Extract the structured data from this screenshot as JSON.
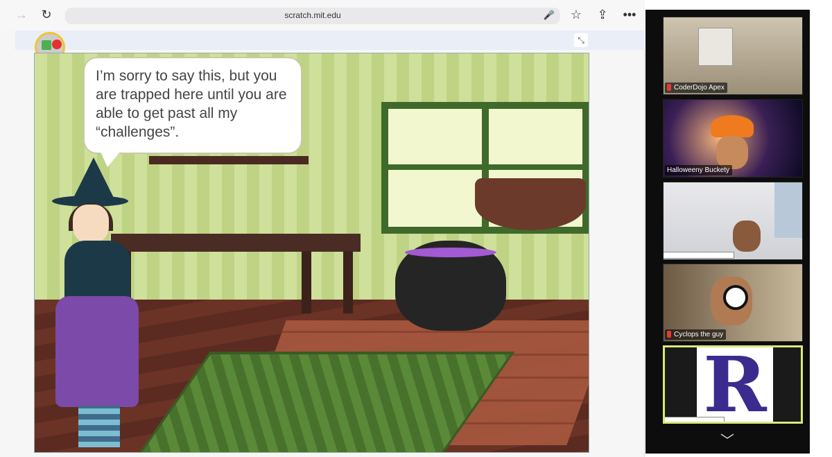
{
  "browser": {
    "url": "scratch.mit.edu",
    "icons": {
      "forward": "arrow-right-icon",
      "reload": "reload-icon",
      "mic": "microphone-icon",
      "bookmark": "star-icon",
      "share": "share-icon",
      "more": "ellipsis-icon",
      "fullscreen": "shrink-icon"
    }
  },
  "stage": {
    "speech": "I’m sorry to say this, but you are trapped here until you are able to get past all my “challenges”."
  },
  "participants": [
    {
      "name": "CoderDojo Apex",
      "muted": true
    },
    {
      "name": "Halloweeny Buckety",
      "muted": false
    },
    {
      "name": "",
      "muted": false
    },
    {
      "name": "Cyclops the guy",
      "muted": true
    },
    {
      "name": "",
      "muted": false
    }
  ],
  "colors": {
    "accent_active": "#d9e87a",
    "mute": "#e53935"
  }
}
